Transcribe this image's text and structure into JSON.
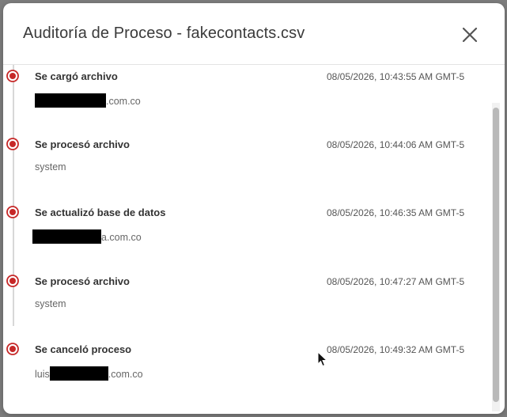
{
  "modal": {
    "title": "Auditoría de Proceso - fakecontacts.csv",
    "close_label": "close"
  },
  "events": [
    {
      "title": "Se cargó archivo",
      "time": "08/05/2026, 10:43:55 AM GMT-5",
      "user_prefix": "",
      "user_suffix": ".com.co",
      "redacted": true
    },
    {
      "title": "Se procesó archivo",
      "time": "08/05/2026, 10:44:06 AM GMT-5",
      "user_prefix": "system",
      "user_suffix": "",
      "redacted": false
    },
    {
      "title": "Se actualizó base de datos",
      "time": "08/05/2026, 10:46:35 AM GMT-5",
      "user_prefix": "",
      "user_suffix": "a.com.co",
      "redacted": true
    },
    {
      "title": "Se procesó archivo",
      "time": "08/05/2026, 10:47:27 AM GMT-5",
      "user_prefix": "system",
      "user_suffix": "",
      "redacted": false
    },
    {
      "title": "Se canceló proceso",
      "time": "08/05/2026, 10:49:32 AM GMT-5",
      "user_prefix": "luis",
      "user_suffix": ".com.co",
      "redacted": true
    }
  ],
  "colors": {
    "accent": "#c62828",
    "title": "#3a3a3a",
    "text": "#333333",
    "muted": "#666666"
  },
  "icons": {
    "close": "close-icon",
    "event_marker": "radio-dot-icon",
    "cursor": "mouse-pointer-icon"
  }
}
